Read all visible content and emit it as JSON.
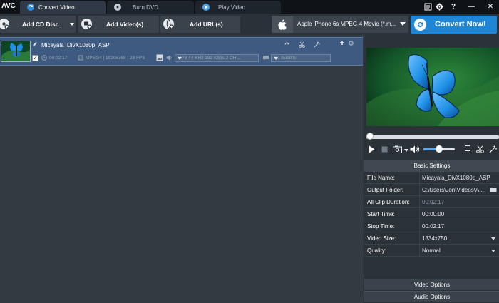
{
  "app": {
    "logo": "AVC",
    "tabs": [
      {
        "label": "Convert Video",
        "active": true,
        "icon": "convert-video-icon"
      },
      {
        "label": "Burn DVD",
        "active": false,
        "icon": "disc-icon"
      },
      {
        "label": "Play Video",
        "active": false,
        "icon": "play-circle-icon"
      }
    ],
    "window_controls": [
      "menu-icon",
      "gear-icon",
      "help-icon",
      "minimize-icon",
      "close-icon"
    ],
    "window_glyphs": {
      "help": "?",
      "minimize": "—",
      "close": "✕"
    }
  },
  "toolbar": {
    "add_cd_label": "Add CD Disc",
    "add_video_label": "Add Video(s)",
    "add_url_label": "Add URL(s)",
    "profile_label": "Apple iPhone 6s MPEG-4 Movie (*.m...",
    "convert_label": "Convert Now!"
  },
  "file": {
    "name": "Micayala_DivX1080p_ASP",
    "duration": "00:02:17",
    "video_info": "MPEG4 | 1920x768 | 23 FPS",
    "audio_track": "MP3 44 KHz 192 Kbps 2 CH ...",
    "subtitle": "No Subtitle",
    "checked": true
  },
  "settings": {
    "header": "Basic Settings",
    "rows": [
      {
        "label": "File Name:",
        "value": "Micayala_DivX1080p_ASP",
        "dim": false,
        "dropdown": false
      },
      {
        "label": "Output Folder:",
        "value": "C:\\Users\\Jon\\Videos\\A...",
        "dim": false,
        "dropdown": false
      },
      {
        "label": "All Clip Duration:",
        "value": "00:02:17",
        "dim": true,
        "dropdown": false
      },
      {
        "label": "Start Time:",
        "value": "00:00:00",
        "dim": false,
        "dropdown": false
      },
      {
        "label": "Stop Time:",
        "value": "00:02:17",
        "dim": false,
        "dropdown": false
      },
      {
        "label": "Video Size:",
        "value": "1334x750",
        "dim": false,
        "dropdown": true
      },
      {
        "label": "Quality:",
        "value": "Normal",
        "dim": false,
        "dropdown": true
      }
    ],
    "video_options_label": "Video Options",
    "audio_options_label": "Audio Options"
  },
  "player": {
    "seek_fraction": 0.0,
    "volume_fraction": 0.5
  },
  "colors": {
    "accent": "#1f86d6",
    "selected_row": "#3e5a80",
    "butterfly": "#1e8fe6"
  }
}
